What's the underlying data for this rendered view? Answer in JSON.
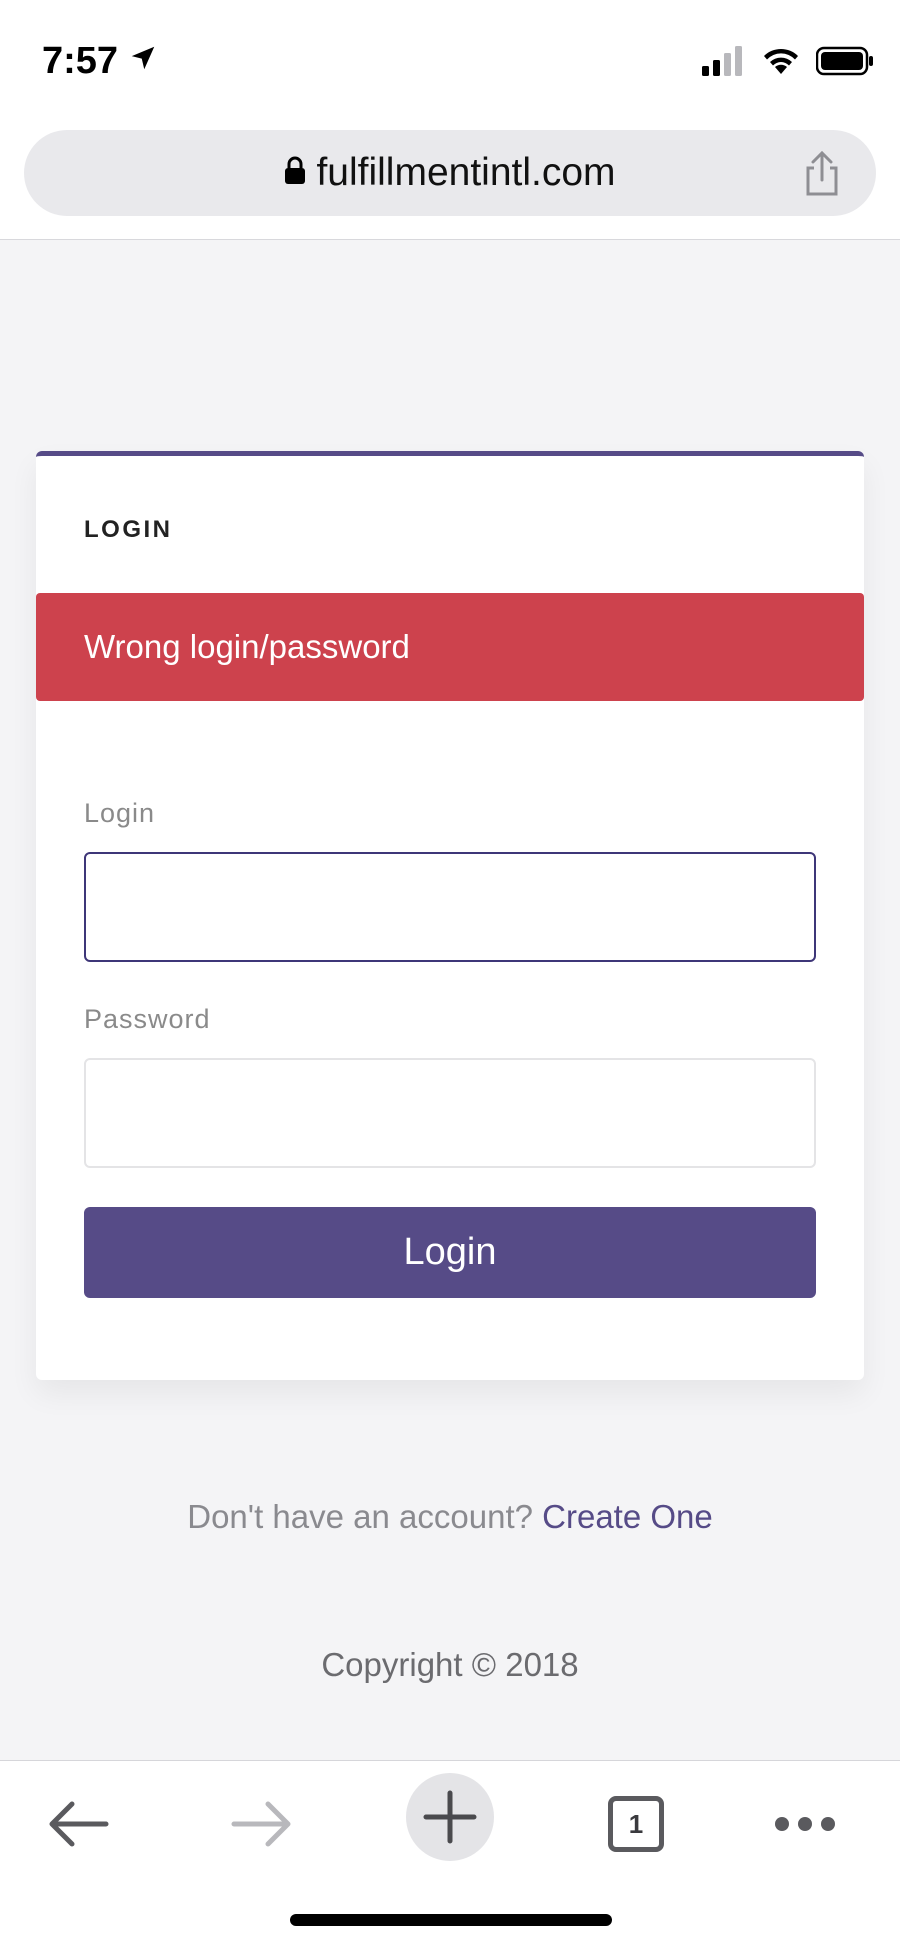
{
  "status_bar": {
    "time": "7:57",
    "icons": [
      "location-arrow-icon",
      "cellular-signal-icon",
      "wifi-icon",
      "battery-icon"
    ]
  },
  "browser": {
    "url": "fulfillmentintl.com",
    "lock_icon": "lock-icon",
    "share_icon": "share-icon"
  },
  "login_card": {
    "title": "LOGIN",
    "error_message": "Wrong login/password",
    "login_label": "Login",
    "login_value": "",
    "password_label": "Password",
    "password_value": "",
    "submit_label": "Login"
  },
  "footer": {
    "signup_prompt": "Don't have an account?",
    "signup_link": "Create One",
    "copyright": "Copyright © 2018"
  },
  "toolbar": {
    "tab_count": "1",
    "buttons": [
      "back-icon",
      "forward-icon",
      "new-tab-icon",
      "tabs-icon",
      "more-icon"
    ]
  },
  "colors": {
    "accent": "#564b87",
    "error": "#cd424d",
    "page_background": "#f4f4f6"
  }
}
